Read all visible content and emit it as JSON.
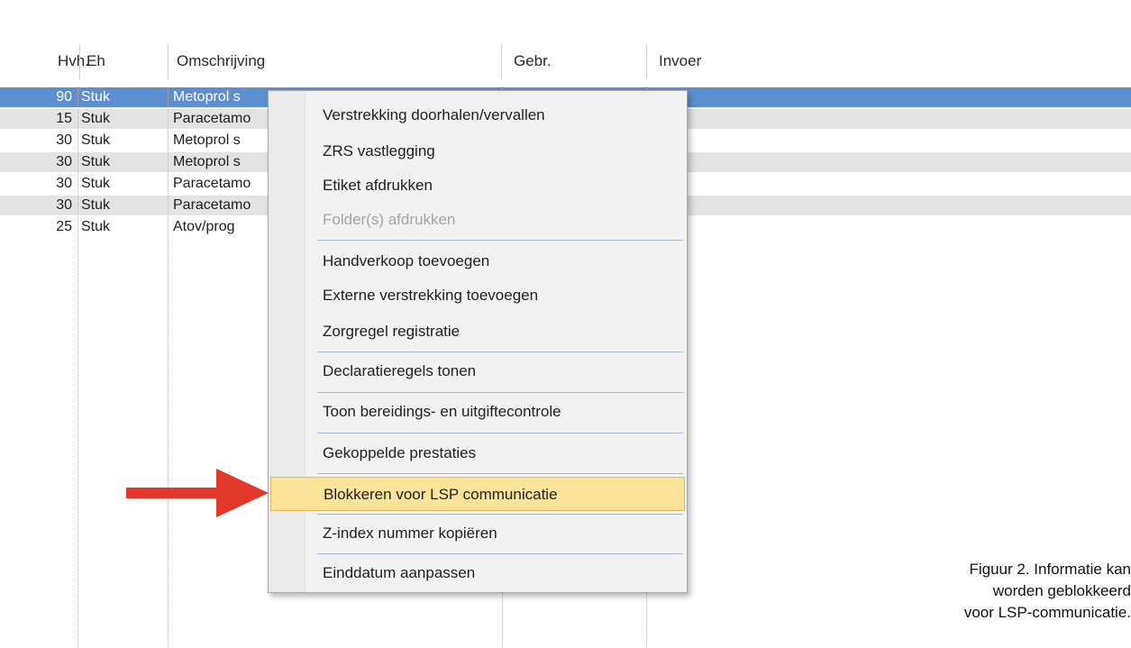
{
  "columns": {
    "qty": "Hvh.",
    "unit": "Eh",
    "description": "Omschrijving",
    "usage": "Gebr.",
    "entry": "Invoer"
  },
  "rows": [
    {
      "qty": "90",
      "unit": "Stuk",
      "description": "Metoprol s",
      "selected": true
    },
    {
      "qty": "15",
      "unit": "Stuk",
      "description": "Paracetamo",
      "selected": false
    },
    {
      "qty": "30",
      "unit": "Stuk",
      "description": "Metoprol s",
      "selected": false
    },
    {
      "qty": "30",
      "unit": "Stuk",
      "description": "Metoprol s",
      "selected": false
    },
    {
      "qty": "30",
      "unit": "Stuk",
      "description": "Paracetamo",
      "selected": false
    },
    {
      "qty": "30",
      "unit": "Stuk",
      "description": "Paracetamo",
      "selected": false
    },
    {
      "qty": "25",
      "unit": "Stuk",
      "description": "Atov/prog",
      "selected": false
    }
  ],
  "context_menu": {
    "items": [
      {
        "label": "Verstrekking doorhalen/vervallen",
        "disabled": false
      },
      {
        "label": "ZRS vastlegging",
        "disabled": false
      },
      {
        "label": "Etiket afdrukken",
        "disabled": false
      },
      {
        "label": "Folder(s) afdrukken",
        "disabled": true
      },
      {
        "label": "Handverkoop toevoegen",
        "disabled": false
      },
      {
        "label": "Externe verstrekking toevoegen",
        "disabled": false
      },
      {
        "label": "Zorgregel registratie",
        "disabled": false
      },
      {
        "label": "Declaratieregels tonen",
        "disabled": false
      },
      {
        "label": "Toon bereidings- en uitgiftecontrole",
        "disabled": false
      },
      {
        "label": "Gekoppelde prestaties",
        "disabled": false
      },
      {
        "label": "Blokkeren voor LSP communicatie",
        "disabled": false,
        "highlighted": true
      },
      {
        "label": "Z-index nummer kopiëren",
        "disabled": false
      },
      {
        "label": "Einddatum aanpassen",
        "disabled": false
      }
    ]
  },
  "annotation": {
    "arrow_icon": "arrow-right-icon",
    "arrow_color": "#e2382a"
  },
  "caption": {
    "line1": "Figuur 2. Informatie kan",
    "line2": "worden geblokkeerd",
    "line3": "voor LSP-communicatie."
  },
  "colors": {
    "selection": "#5d8fd0",
    "alt_row": "#e3e3e3",
    "menu_highlight": "#fbe39a",
    "menu_highlight_border": "#e2b858"
  }
}
